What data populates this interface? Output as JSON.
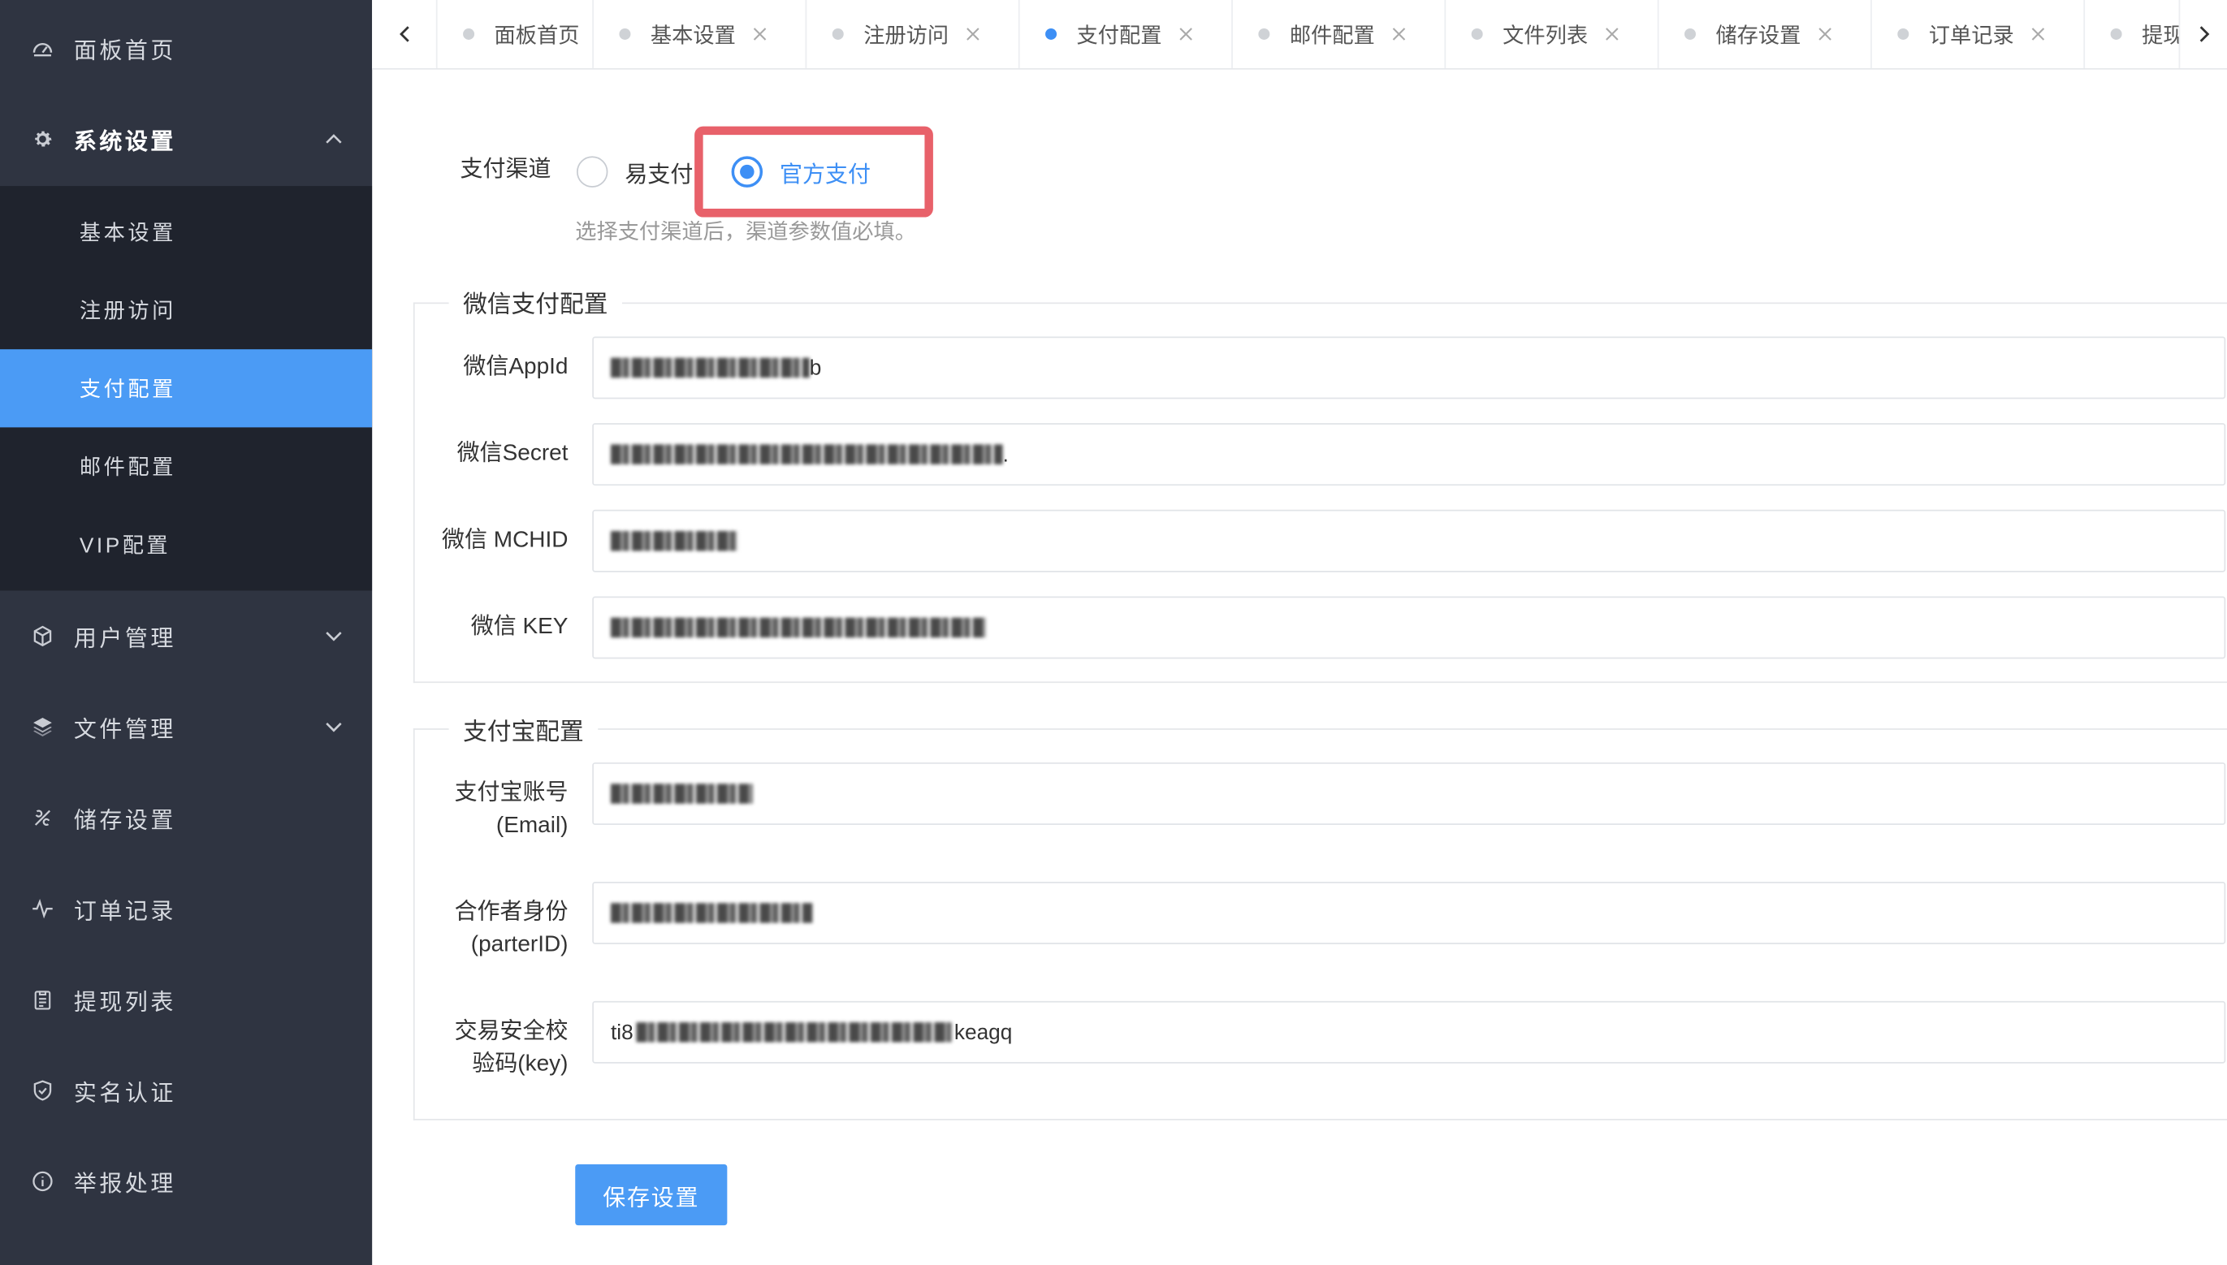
{
  "sidebar": {
    "items": [
      {
        "label": "面板首页",
        "icon": "dashboard-icon"
      },
      {
        "label": "系统设置",
        "icon": "gear-icon"
      },
      {
        "label": "用户管理",
        "icon": "cube-icon"
      },
      {
        "label": "文件管理",
        "icon": "layers-icon"
      },
      {
        "label": "储存设置",
        "icon": "tools-icon"
      },
      {
        "label": "订单记录",
        "icon": "pulse-icon"
      },
      {
        "label": "提现列表",
        "icon": "clipboard-icon"
      },
      {
        "label": "实名认证",
        "icon": "shield-check-icon"
      },
      {
        "label": "举报处理",
        "icon": "info-circle-icon"
      }
    ],
    "submenu": [
      {
        "label": "基本设置"
      },
      {
        "label": "注册访问"
      },
      {
        "label": "支付配置"
      },
      {
        "label": "邮件配置"
      },
      {
        "label": "VIP配置"
      }
    ]
  },
  "tabs": [
    {
      "label": "面板首页",
      "closable": false
    },
    {
      "label": "基本设置",
      "closable": true
    },
    {
      "label": "注册访问",
      "closable": true
    },
    {
      "label": "支付配置",
      "closable": true,
      "active": true
    },
    {
      "label": "邮件配置",
      "closable": true
    },
    {
      "label": "文件列表",
      "closable": true
    },
    {
      "label": "储存设置",
      "closable": true
    },
    {
      "label": "订单记录",
      "closable": true
    },
    {
      "label": "提现",
      "closable": false
    }
  ],
  "form": {
    "channel_label": "支付渠道",
    "channel_options": [
      "易支付",
      "官方支付"
    ],
    "channel_selected": "官方支付",
    "channel_hint": "选择支付渠道后，渠道参数值必填。",
    "wechat": {
      "legend": "微信支付配置",
      "fields": [
        {
          "label": "微信AppId",
          "value_tail": "b"
        },
        {
          "label": "微信Secret",
          "value_tail": "."
        },
        {
          "label": "微信 MCHID",
          "value_tail": ""
        },
        {
          "label": "微信 KEY",
          "value_tail": ""
        }
      ]
    },
    "alipay": {
      "legend": "支付宝配置",
      "fields": [
        {
          "label_line1": "支付宝账号",
          "label_line2": "(Email)",
          "value_head": "",
          "value_tail": ""
        },
        {
          "label_line1": "合作者身份",
          "label_line2": "(parterID)",
          "value_head": "",
          "value_tail": ""
        },
        {
          "label_line1": "交易安全校",
          "label_line2": "验码(key)",
          "value_head": "ti8",
          "value_tail": "keagq"
        }
      ]
    },
    "save_label": "保存设置"
  },
  "colors": {
    "accent": "#4b9bf5",
    "sidebar_bg": "#2f3441",
    "highlight": "#e8616a"
  }
}
